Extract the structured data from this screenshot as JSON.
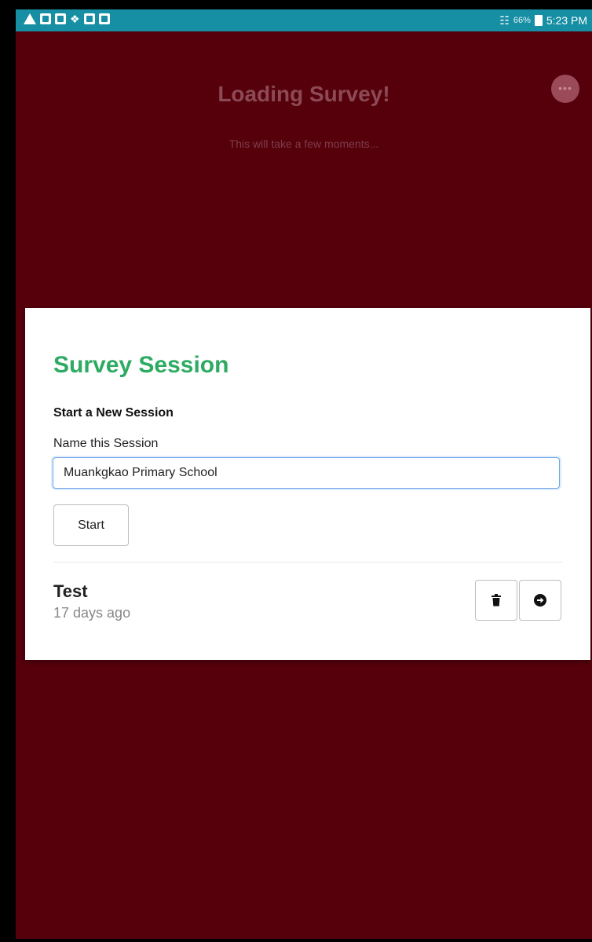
{
  "statusbar": {
    "battery_percent": "66%",
    "time": "5:23 PM",
    "icons": [
      "alert-icon",
      "gallery-icon",
      "mail-icon",
      "dropbox-icon",
      "mail-icon",
      "photo-icon",
      "wifi-icon",
      "battery-icon"
    ]
  },
  "background": {
    "title": "Loading Survey!",
    "subtitle": "This will take a few moments..."
  },
  "modal": {
    "title": "Survey Session",
    "section_heading": "Start a New Session",
    "field_label": "Name this Session",
    "name_value": "Muankgkao Primary School",
    "start_label": "Start"
  },
  "sessions": [
    {
      "name": "Test",
      "created": "17 days ago"
    }
  ],
  "colors": {
    "background": "#56000c",
    "statusbar": "#168ea3",
    "title_green": "#2eab62",
    "input_focus": "#6ba6e8"
  }
}
